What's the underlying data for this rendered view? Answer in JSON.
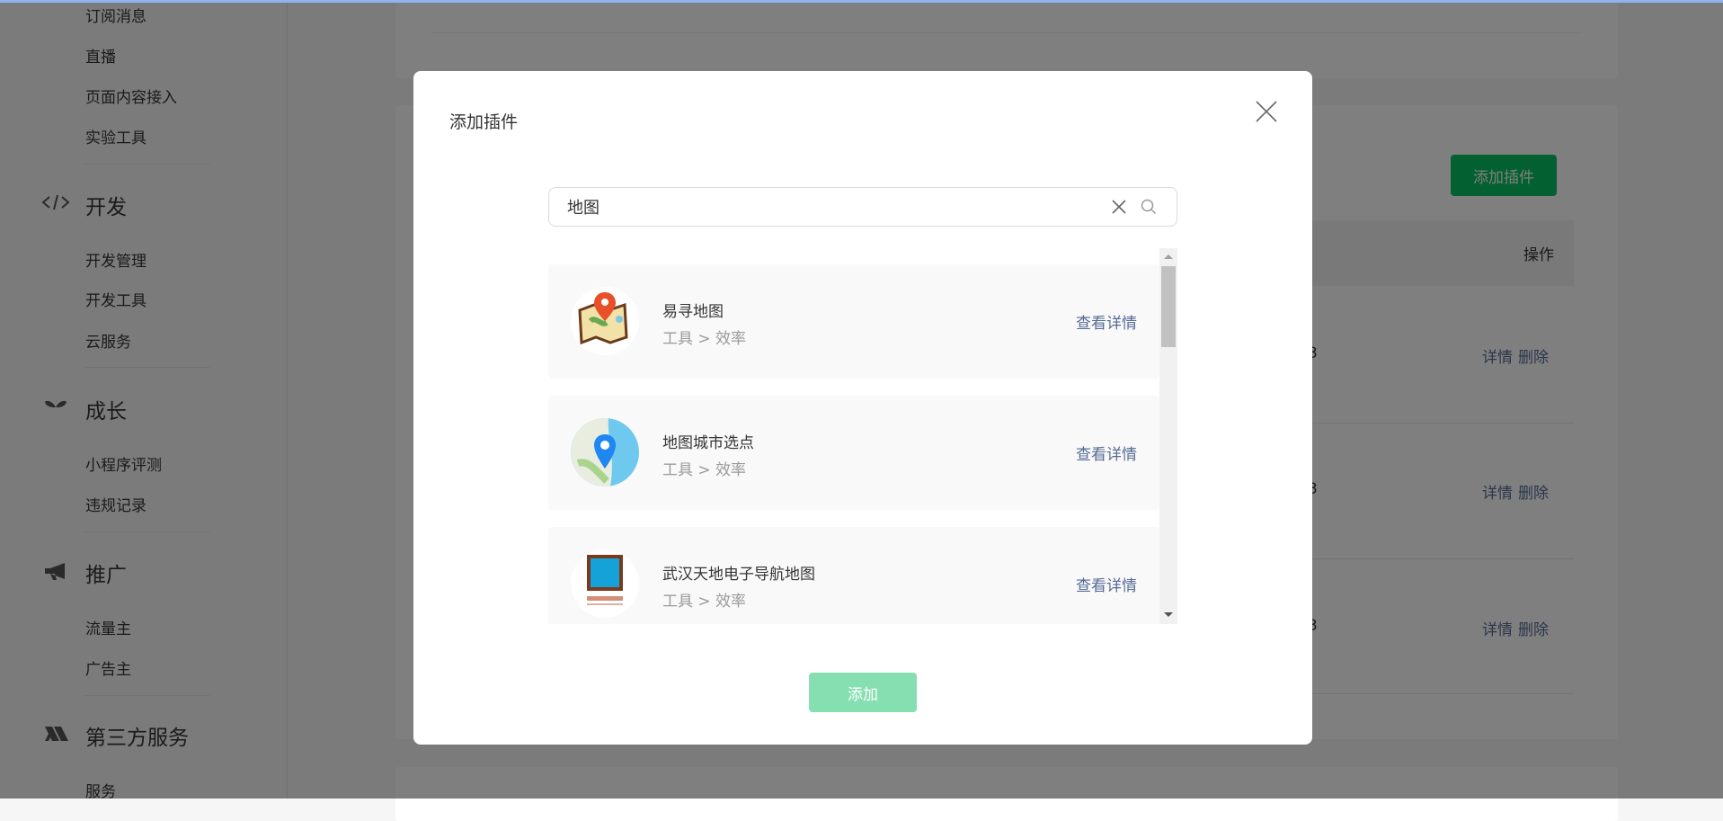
{
  "sidebar": {
    "items_top": [
      "订阅消息",
      "直播",
      "页面内容接入",
      "实验工具"
    ],
    "sections": [
      {
        "title": "开发",
        "icon": "code-icon",
        "items": [
          "开发管理",
          "开发工具",
          "云服务"
        ]
      },
      {
        "title": "成长",
        "icon": "sprout-icon",
        "items": [
          "小程序评测",
          "违规记录"
        ]
      },
      {
        "title": "推广",
        "icon": "megaphone-icon",
        "items": [
          "流量主",
          "广告主"
        ]
      },
      {
        "title": "第三方服务",
        "icon": "third-party-icon",
        "items": [
          "服务"
        ]
      }
    ]
  },
  "main": {
    "add_plugin_button": "添加插件",
    "table": {
      "op_header": "操作",
      "rows": [
        {
          "version_fragment": "3",
          "detail": "详情",
          "delete": "删除"
        },
        {
          "version_fragment": "3",
          "detail": "详情",
          "delete": "删除"
        },
        {
          "version_fragment": "3",
          "detail": "详情",
          "delete": "删除"
        }
      ]
    },
    "accent_color": "#07c160"
  },
  "modal": {
    "title": "添加插件",
    "search_value": "地图",
    "results": [
      {
        "name": "易寻地图",
        "category": "工具 > 效率",
        "action": "查看详情",
        "icon": "folded-map-pin-icon"
      },
      {
        "name": "地图城市选点",
        "category": "工具 > 效率",
        "action": "查看详情",
        "icon": "city-map-pin-icon"
      },
      {
        "name": "武汉天地电子导航地图",
        "category": "工具 > 效率",
        "action": "查看详情",
        "icon": "wuhan-tiandi-logo-icon"
      }
    ],
    "confirm_button": "添加"
  }
}
